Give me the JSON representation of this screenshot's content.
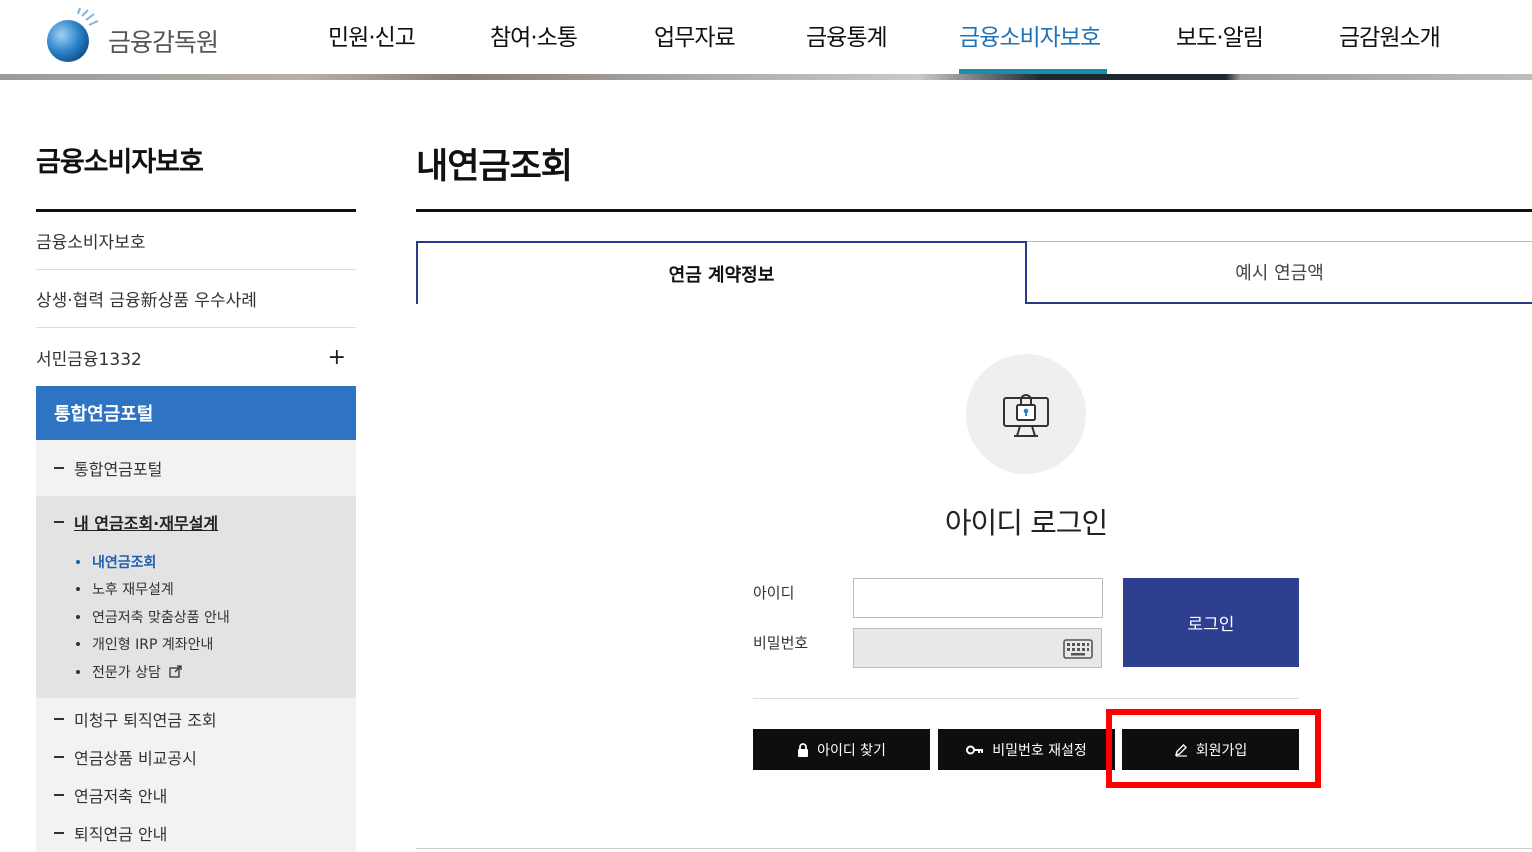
{
  "header": {
    "logo_text": "금융감독원",
    "nav": [
      {
        "label": "민원·신고"
      },
      {
        "label": "참여·소통"
      },
      {
        "label": "업무자료"
      },
      {
        "label": "금융통계"
      },
      {
        "label": "금융소비자보호",
        "active": true
      },
      {
        "label": "보도·알림"
      },
      {
        "label": "금감원소개"
      }
    ],
    "accent_color": "#1f73b7"
  },
  "sidebar": {
    "title": "금융소비자보호",
    "items": [
      {
        "label": "금융소비자보호"
      },
      {
        "label": "상생·협력 금융新상품 우수사례"
      },
      {
        "label": "서민금융1332",
        "expand_icon": "plus-icon"
      }
    ],
    "active_section": "통합연금포털",
    "sub_items": [
      {
        "label": "통합연금포털"
      }
    ],
    "open_group": {
      "label": "내 연금조회·재무설계",
      "leaves": [
        {
          "label": "내연금조회",
          "current": true
        },
        {
          "label": "노후 재무설계"
        },
        {
          "label": "연금저축 맞춤상품 안내"
        },
        {
          "label": "개인형 IRP 계좌안내"
        },
        {
          "label": "전문가 상담",
          "icon": "external-link-icon"
        }
      ]
    },
    "more_items": [
      {
        "label": "미청구 퇴직연금 조회"
      },
      {
        "label": "연금상품 비교공시"
      },
      {
        "label": "연금저축 안내"
      },
      {
        "label": "퇴직연금 안내"
      }
    ]
  },
  "main": {
    "title": "내연금조회",
    "tabs": [
      {
        "label": "연금 계약정보",
        "selected": true
      },
      {
        "label": "예시 연금액"
      }
    ],
    "login": {
      "icon": "computer-lock-icon",
      "heading": "아이디 로그인",
      "id_label": "아이디",
      "id_value": "",
      "pw_label": "비밀번호",
      "pw_value": "",
      "keyboard_icon": "keyboard-icon",
      "submit_label": "로그인",
      "find_id_label": "아이디 찾기",
      "reset_pw_label": "비밀번호 재설정",
      "signup_label": "회원가입"
    },
    "colors": {
      "primary_button": "#2e3f8f",
      "tab_border": "#2b3a8a",
      "highlight": "#ff0000"
    }
  }
}
